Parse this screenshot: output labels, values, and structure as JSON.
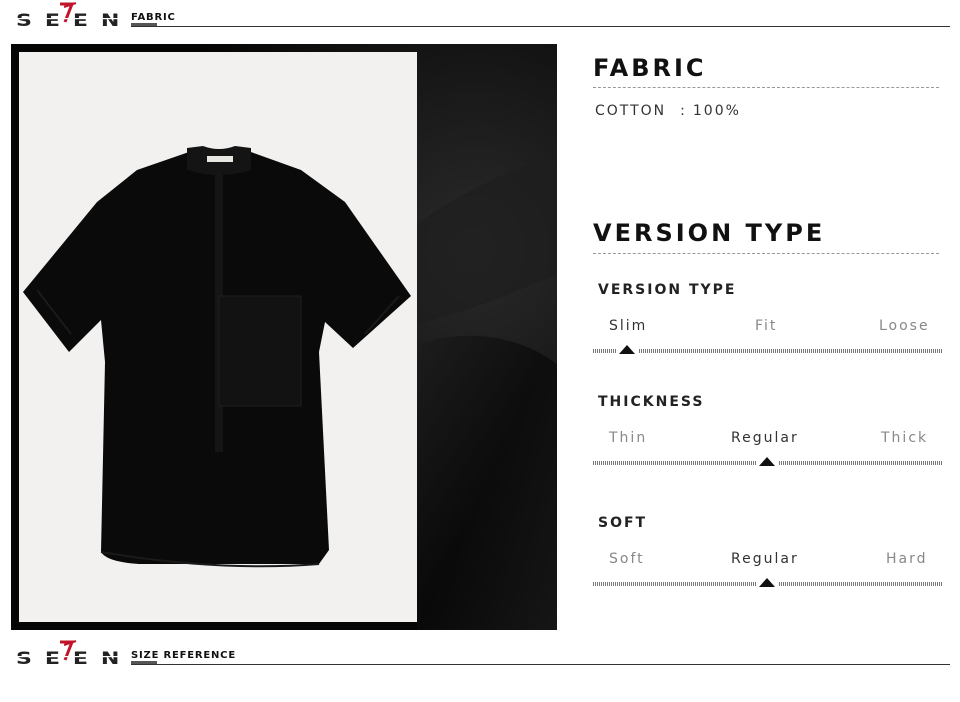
{
  "header": {
    "brand": "SEVEN",
    "section": "FABRIC"
  },
  "footer": {
    "brand": "SEVEN",
    "section": "SIZE REFERENCE"
  },
  "fabric": {
    "title": "FABRIC",
    "material": "COTTON",
    "separator": ":",
    "percent": "100%"
  },
  "version": {
    "title": "VERSION TYPE",
    "scales": [
      {
        "title": "VERSION TYPE",
        "options": [
          "Slim",
          "Fit",
          "Loose"
        ],
        "selected_index": 0
      },
      {
        "title": "THICKNESS",
        "options": [
          "Thin",
          "Regular",
          "Thick"
        ],
        "selected_index": 1
      },
      {
        "title": "SOFT",
        "options": [
          "Soft",
          "Regular",
          "Hard"
        ],
        "selected_index": 1
      }
    ]
  },
  "colors": {
    "logo_accent": "#c0142b",
    "logo_text": "#222222",
    "shirt": "#0a0a0a"
  }
}
